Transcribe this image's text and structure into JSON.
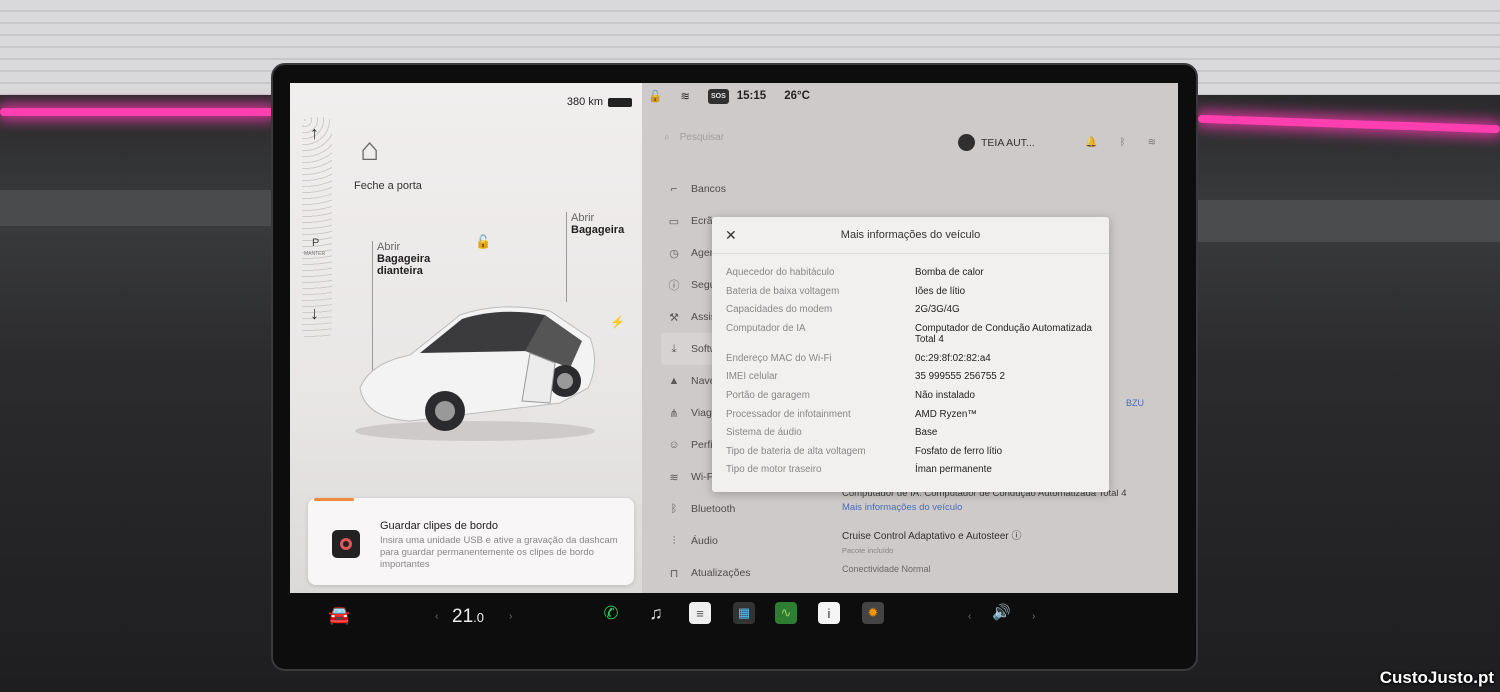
{
  "colors": {
    "accent_link": "#3a6ec4",
    "clip_progress": "#f08a3c",
    "ambient_glow": "#ff3fb0"
  },
  "watermark": "CustoJusto.pt",
  "status": {
    "range": "380 km",
    "time": "15:15",
    "temperature": "26°C",
    "sos": "SOS"
  },
  "car_panel": {
    "close_door": "Feche a porta",
    "gear": "P",
    "gear_sub": "MANTER",
    "frunk": {
      "action": "Abrir",
      "label": "Bagageira dianteira"
    },
    "trunk": {
      "action": "Abrir",
      "label": "Bagageira"
    },
    "clip_card": {
      "title": "Guardar clipes de bordo",
      "description": "Insira uma unidade USB e ative a gravação da dashcam para guardar permanentemente os clipes de bordo importantes"
    }
  },
  "settings": {
    "search_placeholder": "Pesquisar",
    "profile_name": "TEIA AUT...",
    "menu": [
      {
        "label": "Bancos",
        "icon": "seat-icon"
      },
      {
        "label": "Ecrã",
        "icon": "display-icon"
      },
      {
        "label": "Agendamento",
        "icon": "clock-icon"
      },
      {
        "label": "Segurança",
        "icon": "shield-icon"
      },
      {
        "label": "Assistência",
        "icon": "wrench-icon"
      },
      {
        "label": "Software",
        "icon": "download-icon"
      },
      {
        "label": "Navegação",
        "icon": "navigation-icon"
      },
      {
        "label": "Viagens",
        "icon": "trips-icon"
      },
      {
        "label": "Perfis",
        "icon": "profile-icon"
      },
      {
        "label": "Wi-Fi",
        "icon": "wifi-icon"
      },
      {
        "label": "Bluetooth",
        "icon": "bluetooth-icon"
      },
      {
        "label": "Áudio",
        "icon": "sliders-icon"
      },
      {
        "label": "Atualizações",
        "icon": "lock-icon"
      }
    ],
    "detail": {
      "ai_line": "Computador de IA: Computador de Condução Automatizada Total 4",
      "more_info_link": "Mais informações do veículo",
      "cruise_heading": "Cruise Control Adaptativo e Autosteer",
      "cruise_sub": "Pacote incluído",
      "connectivity": "Conectividade Normal",
      "side_code": "BZU"
    }
  },
  "modal": {
    "title": "Mais informações do veículo",
    "rows": [
      {
        "label": "Aquecedor do habitáculo",
        "value": "Bomba de calor"
      },
      {
        "label": "Bateria de baixa voltagem",
        "value": "Iões de lítio"
      },
      {
        "label": "Capacidades do modem",
        "value": "2G/3G/4G"
      },
      {
        "label": "Computador de IA",
        "value": "Computador de Condução Automatizada Total 4"
      },
      {
        "label": "Endereço MAC do Wi-Fi",
        "value": "0c:29:8f:02:82:a4"
      },
      {
        "label": "IMEI celular",
        "value": "35 999555 256755 2"
      },
      {
        "label": "Portão de garagem",
        "value": "Não instalado"
      },
      {
        "label": "Processador de infotainment",
        "value": "AMD Ryzen™"
      },
      {
        "label": "Sistema de áudio",
        "value": "Base"
      },
      {
        "label": "Tipo de bateria de alta voltagem",
        "value": "Fosfato de ferro lítio"
      },
      {
        "label": "Tipo de motor traseiro",
        "value": "Íman permanente"
      }
    ]
  },
  "taskbar": {
    "temp_int": "21",
    "temp_dec": ".0"
  }
}
